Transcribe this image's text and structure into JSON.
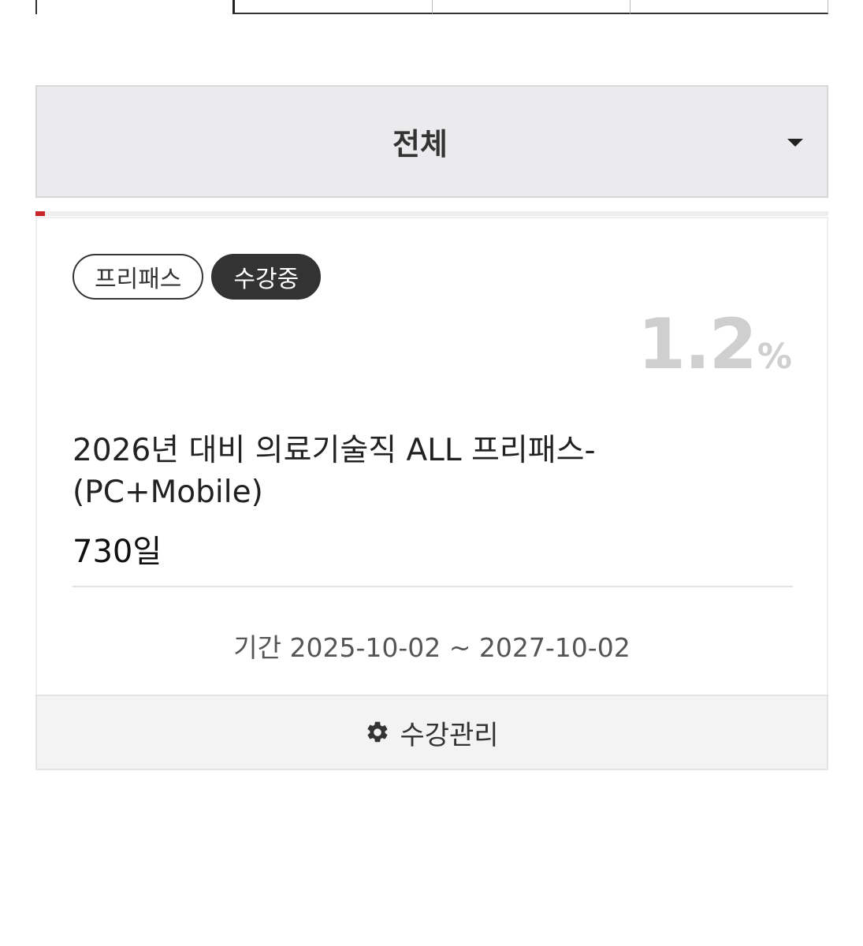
{
  "filter": {
    "selected": "전체"
  },
  "course": {
    "badges": [
      "프리패스",
      "수강중"
    ],
    "progress_value": "1.2",
    "progress_unit": "%",
    "title_line1": "2026년 대비 의료기술직 ALL 프리패스-",
    "title_line2": "(PC+Mobile)",
    "duration": "730일",
    "period": "기간 2025-10-02 ~ 2027-10-02",
    "manage_label": "수강관리"
  },
  "colors": {
    "accent": "#c8262b",
    "badge_filled": "#333333",
    "percent_text": "#cfcfcf"
  },
  "icons": {
    "dropdown": "caret-down-icon",
    "manage": "gear-icon"
  }
}
